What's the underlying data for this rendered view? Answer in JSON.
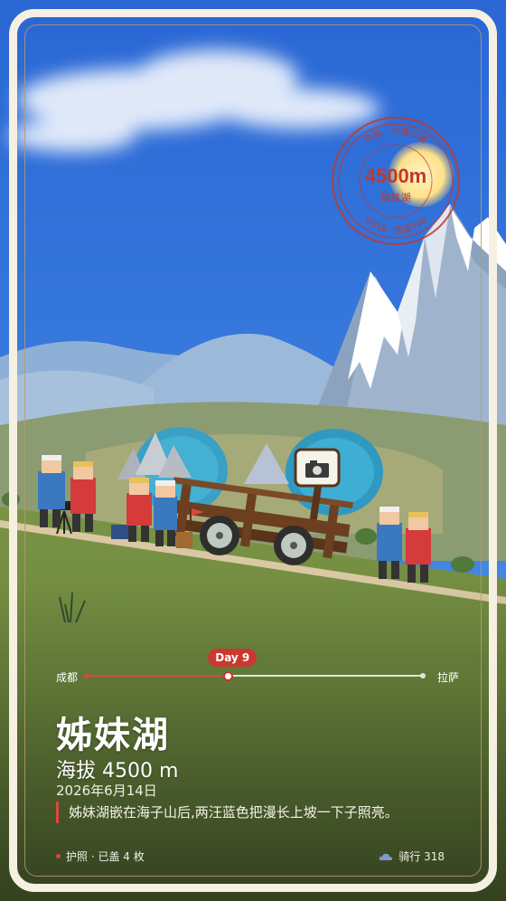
{
  "stamp": {
    "top_text": "中国 · 川藏公路",
    "altitude": "4500m",
    "place": "姊妹湖",
    "bottom_text": "G318 · 国道318",
    "color": "#c0392b"
  },
  "timeline": {
    "start": "成都",
    "end": "拉萨",
    "day_badge": "Day 9",
    "progress": 0.42
  },
  "location": {
    "name": "姊妹湖",
    "altitude": "海拔 4500 m",
    "date": "2026年6月14日",
    "description": "姊妹湖嵌在海子山后,两汪蓝色把漫长上坡一下子照亮。"
  },
  "footer": {
    "stamps": "护照 · 已盖 4 枚",
    "route": "骑行 318"
  },
  "colors": {
    "sky": "#2f6fd8",
    "accent": "#c8392f",
    "frame": "#f6f0e2"
  }
}
